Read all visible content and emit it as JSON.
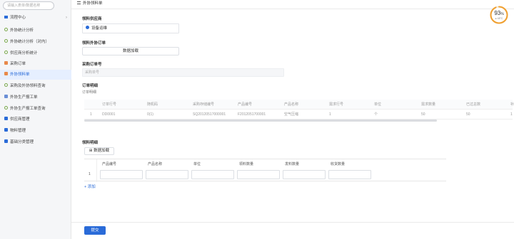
{
  "sidebar": {
    "search_placeholder": "请输入表单/数据名称",
    "items": [
      {
        "label": "流程中心",
        "icon": "tree-icon"
      },
      {
        "label": "外协统计分析",
        "icon": "circle-icon"
      },
      {
        "label": "外协统计分析（对内）",
        "icon": "circle-icon"
      },
      {
        "label": "供应商分析统计",
        "icon": "circle-icon"
      },
      {
        "label": "采购订单",
        "icon": "doc-icon"
      },
      {
        "label": "外协领料单",
        "icon": "doc-icon"
      },
      {
        "label": "采购及外协领料查询",
        "icon": "circle-icon"
      },
      {
        "label": "外协生产报工单",
        "icon": "doc-icon"
      },
      {
        "label": "外协生产报工单查询",
        "icon": "circle-icon"
      },
      {
        "label": "供应商管理",
        "icon": "folder-icon"
      },
      {
        "label": "物料管理",
        "icon": "folder-icon"
      },
      {
        "label": "基础分类管理",
        "icon": "folder-icon"
      }
    ]
  },
  "header": {
    "title": "外协领料单"
  },
  "form": {
    "supplier_label": "领料供应商",
    "supplier_value": "设备运维",
    "vendor_label": "领料外协订单",
    "vendor_button": "数据加载",
    "po_label": "采购订单号",
    "po_placeholder": "采购单号",
    "order_detail_label": "订单明细",
    "order_detail_sub": "订单明细"
  },
  "order_table": {
    "headers": [
      "",
      "订单行号",
      "随机码",
      "采购存储编号",
      "产品编号",
      "产品名称",
      "需求行号",
      "单位",
      "需求数量",
      "已过总数",
      "补"
    ],
    "row": [
      "1",
      "DD0001",
      "0(1)",
      "SQ20120517000001",
      "F2012051700001",
      "空气压缩",
      "1",
      "个",
      "50",
      "50",
      "1"
    ]
  },
  "detail": {
    "label": "领料明细",
    "load_button": "数据加载",
    "headers": [
      "产品编号",
      "产品名称",
      "单位",
      "领料数量",
      "发料数量",
      "收货数量"
    ],
    "row_num": "1",
    "add_label": "添加"
  },
  "footer": {
    "submit_label": "提交"
  },
  "gauge": {
    "value": "93",
    "unit": "%",
    "sub": "● 48°C",
    "percent": 93,
    "color": "#f0a030"
  }
}
